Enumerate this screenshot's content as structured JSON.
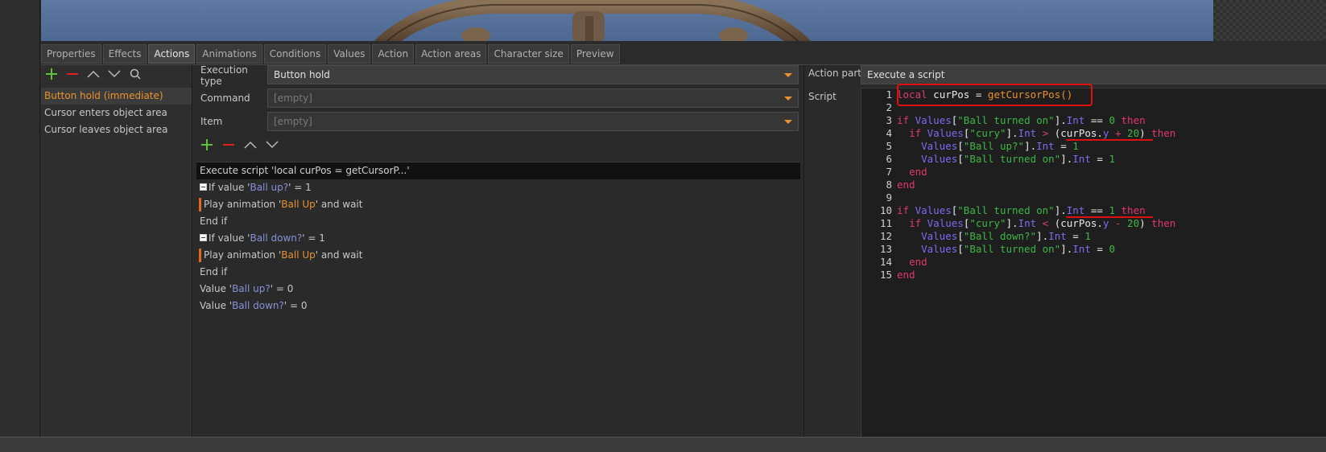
{
  "tabs": [
    "Properties",
    "Effects",
    "Actions",
    "Animations",
    "Conditions",
    "Values",
    "Action",
    "Action areas",
    "Character size",
    "Preview"
  ],
  "active_tab": "Actions",
  "actions": {
    "items": [
      "Button hold (immediate)",
      "Cursor enters object area",
      "Cursor leaves object area"
    ]
  },
  "execution": {
    "type_label": "Execution type",
    "type_value": "Button hold",
    "command_label": "Command",
    "command_value": "[empty]",
    "item_label": "Item",
    "item_value": "[empty]"
  },
  "script_list": {
    "header": "Execute script 'local curPos = getCursorP...'",
    "if1_prefix": "If value '",
    "if1_name": "Ball up?",
    "if1_suffix": "' = 1",
    "play1_prefix": "Play animation '",
    "play1_name": "Ball Up",
    "play1_suffix": "' and wait",
    "endif1": "End if",
    "if2_prefix": "If value '",
    "if2_name": "Ball down?",
    "if2_suffix": "' = 1",
    "play2_prefix": "Play animation '",
    "play2_name": "Ball Up",
    "play2_suffix": "' and wait",
    "endif2": "End if",
    "val1_prefix": "Value '",
    "val1_name": "Ball up?",
    "val1_suffix": "' = 0",
    "val2_prefix": "Value '",
    "val2_name": "Ball down?",
    "val2_suffix": "' = 0"
  },
  "right": {
    "action_part_label": "Action part",
    "action_part_value": "Execute a script",
    "script_label": "Script"
  },
  "colors": {
    "accent": "#e8932f",
    "annotation": "#e01010",
    "keyword": "#e03a6a",
    "string": "#3fb54a",
    "global": "#7b6cf0"
  }
}
